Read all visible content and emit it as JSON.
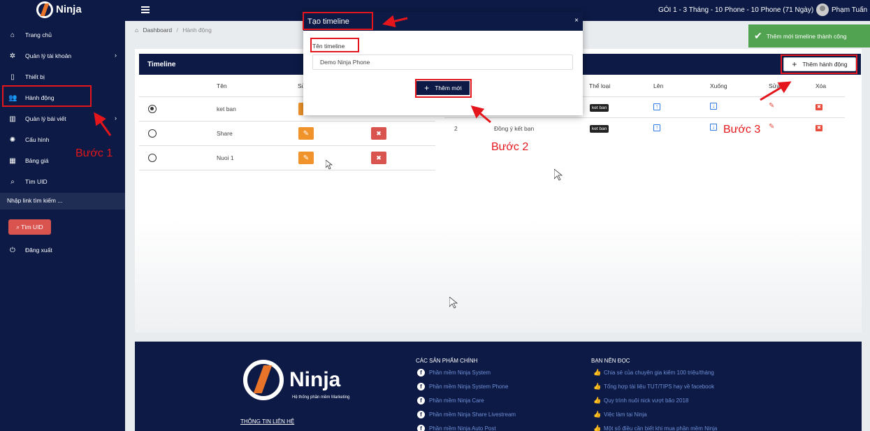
{
  "topbar": {
    "logo_text": "Ninja",
    "plan": "GÓI 1 - 3 Tháng - 10 Phone - 10 Phone (71 Ngày)",
    "user_name": "Phạm Tuấn"
  },
  "sidebar": {
    "items": [
      {
        "label": "Trang chủ",
        "icon": "home-icon"
      },
      {
        "label": "Quản lý tài khoản",
        "icon": "gear-icon"
      },
      {
        "label": "Thiết bị",
        "icon": "phone-icon"
      },
      {
        "label": "Hành động",
        "icon": "users-icon"
      },
      {
        "label": "Quản lý bài viết",
        "icon": "book-icon"
      },
      {
        "label": "Cấu hình",
        "icon": "atom-icon"
      },
      {
        "label": "Bảng giá",
        "icon": "calendar-icon"
      },
      {
        "label": "Tìm UID",
        "icon": "search-icon"
      }
    ],
    "search_link_text": "Nhập link tìm kiếm ...",
    "find_uid_button": "Tìm UID",
    "logout": "Đăng xuất"
  },
  "breadcrumb": {
    "home": "Dashboard",
    "sep": "/",
    "current": "Hành động"
  },
  "timeline_card": {
    "title": "Timeline",
    "col_name": "Tên",
    "col_edit_partial": "Sử",
    "rows": [
      {
        "name": "ket ban",
        "selected": true
      },
      {
        "name": "Share",
        "selected": false
      },
      {
        "name": "Nuoi 1",
        "selected": false
      }
    ]
  },
  "action_card": {
    "add_button": "Thêm hành động",
    "cols": {
      "type": "Thể loại",
      "up": "Lên",
      "down": "Xuống",
      "edit": "Sửa",
      "delete": "Xóa"
    },
    "rows": [
      {
        "index": "",
        "name": "",
        "type": "ket ban"
      },
      {
        "index": "2",
        "name": "Đồng ý kết bạn",
        "type": "ket ban"
      }
    ]
  },
  "modal": {
    "title": "Tạo timeline",
    "close": "×",
    "label": "Tên timeline",
    "input_value": "Demo Ninja Phone",
    "submit": "Thêm mới"
  },
  "toast": {
    "message": "Thêm mới timeline thành công"
  },
  "steps": {
    "step1": "Bước 1",
    "step2": "Bước 2",
    "step3": "Bước 3"
  },
  "footer": {
    "logo_text": "Ninja",
    "logo_sub": "Hệ thống phần mềm Marketing",
    "contact_title": "THÔNG TIN LIÊN HỆ",
    "products_title": "CÁC SẢN PHẨM CHÍNH",
    "products": [
      "Phần mềm Ninja System",
      "Phần mềm Ninja System Phone",
      "Phần mềm Ninja Care",
      "Phần mềm Ninja Share Livestream",
      "Phần mềm Ninja Auto Post"
    ],
    "reading_title": "BẠN NÊN ĐỌC",
    "reading": [
      "Chia sẻ của chuyên gia kiếm 100 triệu/tháng",
      "Tổng hợp tài liệu TUT/TIPS hay về facebook",
      "Quy trình nuôi nick vượt bão 2018",
      "Việc làm tại Ninja",
      "Một số điều cần biết khi mua phần mềm Ninja"
    ]
  },
  "colors": {
    "navy": "#0c1a45",
    "highlight": "#e4161b",
    "success": "#51a351",
    "edit": "#f0932b",
    "delete": "#d9534f"
  }
}
